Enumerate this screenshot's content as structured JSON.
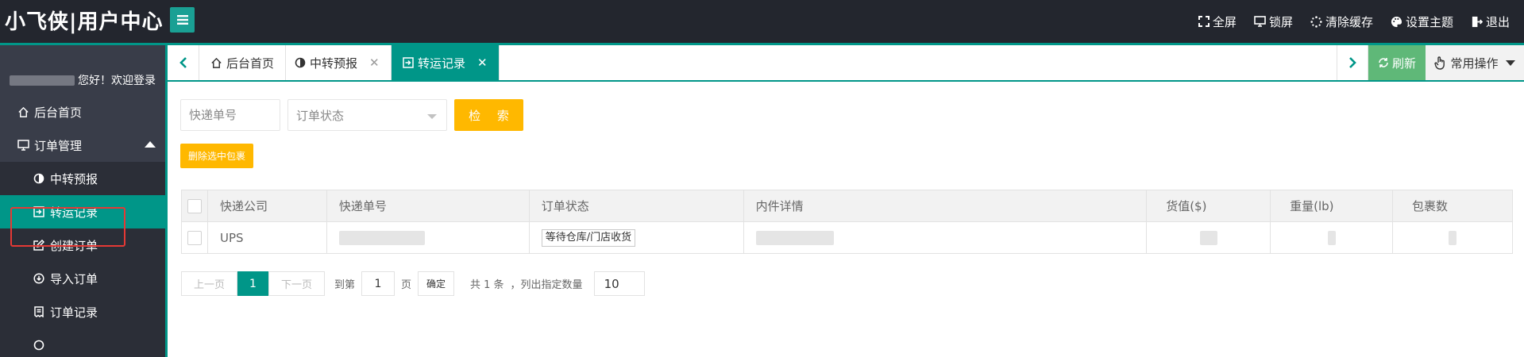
{
  "header": {
    "logo": "小飞侠|用户中心",
    "actions": [
      {
        "label": "全屏",
        "icon": "fullscreen-icon"
      },
      {
        "label": "锁屏",
        "icon": "monitor-icon"
      },
      {
        "label": "清除缓存",
        "icon": "spinner-icon"
      },
      {
        "label": "设置主题",
        "icon": "palette-icon"
      },
      {
        "label": "退出",
        "icon": "logout-icon"
      }
    ]
  },
  "sidebar": {
    "greeting": "您好！欢迎登录",
    "items": [
      {
        "label": "后台首页",
        "icon": "home-icon"
      },
      {
        "label": "订单管理",
        "icon": "monitor-icon"
      },
      {
        "label": "中转预报",
        "icon": "half-circle-icon"
      },
      {
        "label": "转运记录",
        "icon": "sign-in-icon"
      },
      {
        "label": "创建订单",
        "icon": "edit-icon"
      },
      {
        "label": "导入订单",
        "icon": "import-icon"
      },
      {
        "label": "订单记录",
        "icon": "receipt-icon"
      }
    ]
  },
  "tabs": {
    "items": [
      {
        "label": "后台首页"
      },
      {
        "label": "中转预报"
      },
      {
        "label": "转运记录"
      }
    ],
    "refresh": "刷新",
    "ops": "常用操作"
  },
  "search": {
    "tracking_placeholder": "快递单号",
    "status_placeholder": "订单状态",
    "search_button": "检 索",
    "delete_button": "删除选中包裹"
  },
  "table": {
    "columns": [
      "快递公司",
      "快递单号",
      "订单状态",
      "内件详情",
      "货值($)",
      "重量(lb)",
      "包裹数"
    ],
    "rows": [
      {
        "carrier": "UPS",
        "status": "等待仓库/门店收货"
      }
    ]
  },
  "pager": {
    "prev": "上一页",
    "current": "1",
    "next": "下一页",
    "goto_prefix": "到第",
    "goto_value": "1",
    "goto_suffix": "页",
    "confirm": "确定",
    "total": "共 1 条",
    "per_page_label": "，列出指定数量",
    "per_page_value": "10"
  },
  "colors": {
    "accent": "#009688",
    "header_bg": "#23262e",
    "sidebar_bg": "#393d49",
    "warn": "#ffb800",
    "refresh": "#5fb878"
  }
}
